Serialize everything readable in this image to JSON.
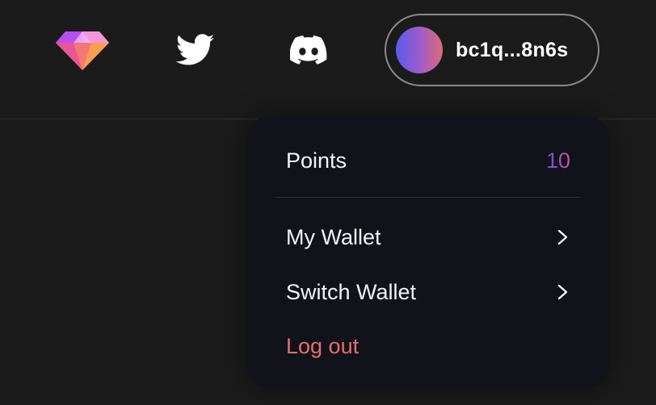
{
  "header": {
    "wallet": {
      "address": "bc1q...8n6s"
    }
  },
  "menu": {
    "points_label": "Points",
    "points_value": "10",
    "items": [
      {
        "label": "My Wallet",
        "icon": "chevron-right-icon"
      },
      {
        "label": "Switch Wallet",
        "icon": "chevron-right-icon"
      }
    ],
    "logout_label": "Log out"
  },
  "icons": {
    "logo": "gem-icon",
    "social": [
      "twitter-icon",
      "discord-icon"
    ]
  },
  "colors": {
    "background": "#1b1b1c",
    "menu_background": "#12121b",
    "logout": "#e2706e",
    "points_gradient": [
      "#6a4fd8",
      "#c45a9c"
    ],
    "avatar_gradient": [
      "#5b5bf0",
      "#e06a7a"
    ]
  }
}
